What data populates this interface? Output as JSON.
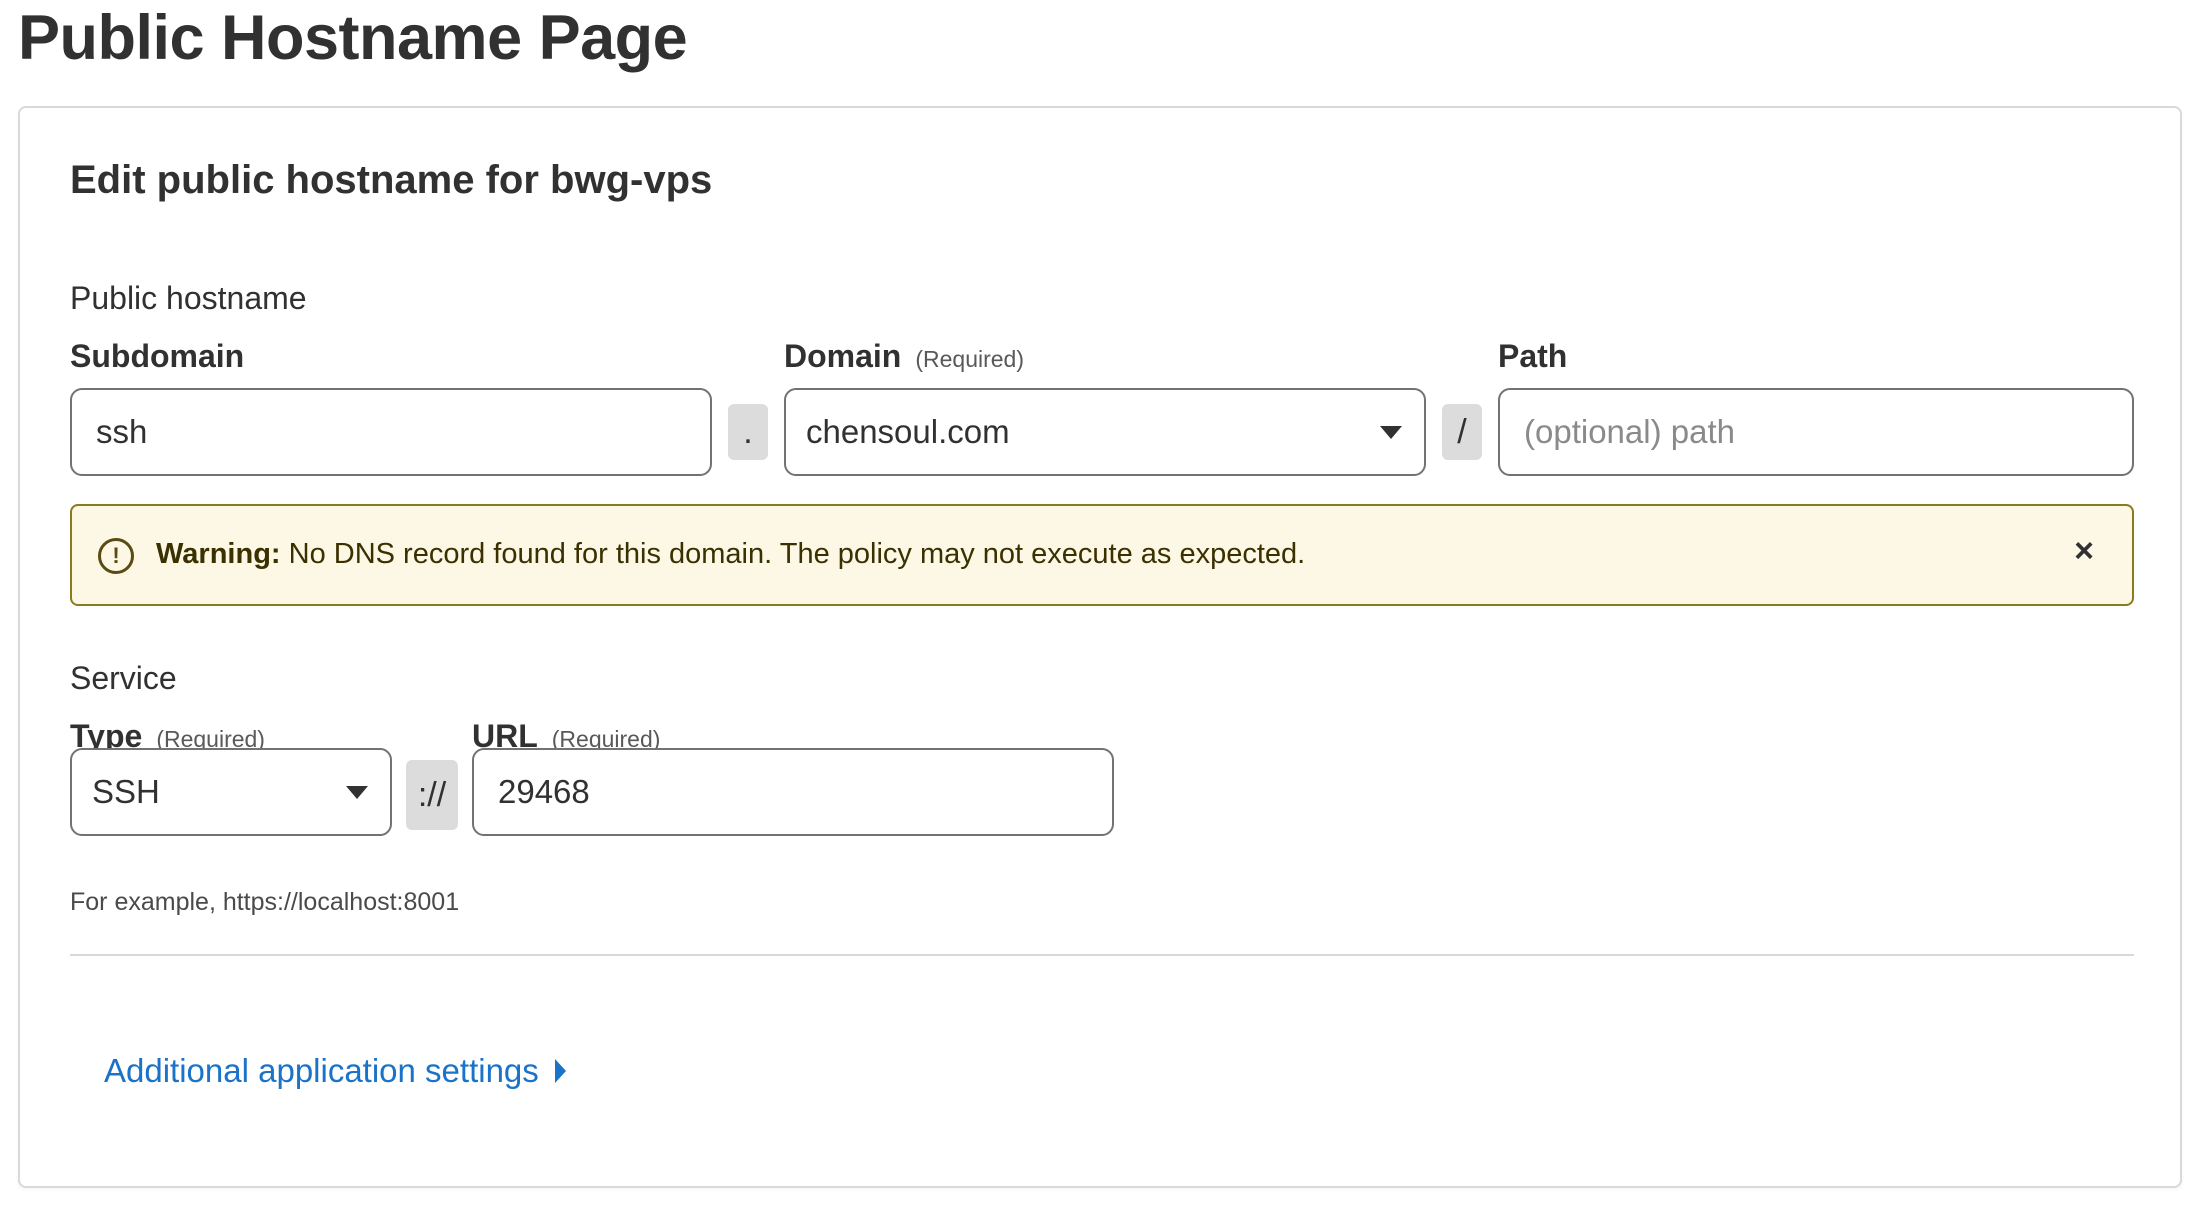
{
  "page": {
    "title": "Public Hostname Page"
  },
  "card": {
    "title": "Edit public hostname for bwg-vps"
  },
  "public_hostname": {
    "section_label": "Public hostname",
    "subdomain": {
      "label": "Subdomain",
      "value": "ssh"
    },
    "dot_separator": ".",
    "domain": {
      "label": "Domain",
      "required": "(Required)",
      "value": "chensoul.com"
    },
    "slash_separator": "/",
    "path": {
      "label": "Path",
      "placeholder": "(optional) path"
    }
  },
  "warning": {
    "strong": "Warning:",
    "message": " No DNS record found for this domain. The policy may not execute as expected.",
    "icon": "exclamation-circle-icon",
    "icon_glyph": "!",
    "close_glyph": "×"
  },
  "service": {
    "section_label": "Service",
    "type": {
      "label": "Type",
      "required": "(Required)",
      "value": "SSH"
    },
    "scheme_separator": "://",
    "url": {
      "label": "URL",
      "required": "(Required)",
      "value": "29468"
    },
    "helper": "For example, https://localhost:8001"
  },
  "additional_settings": {
    "label": "Additional application settings"
  },
  "colors": {
    "link": "#1a73c9",
    "warning_bg": "#fdf8e6",
    "warning_border": "#8c7a1f"
  }
}
